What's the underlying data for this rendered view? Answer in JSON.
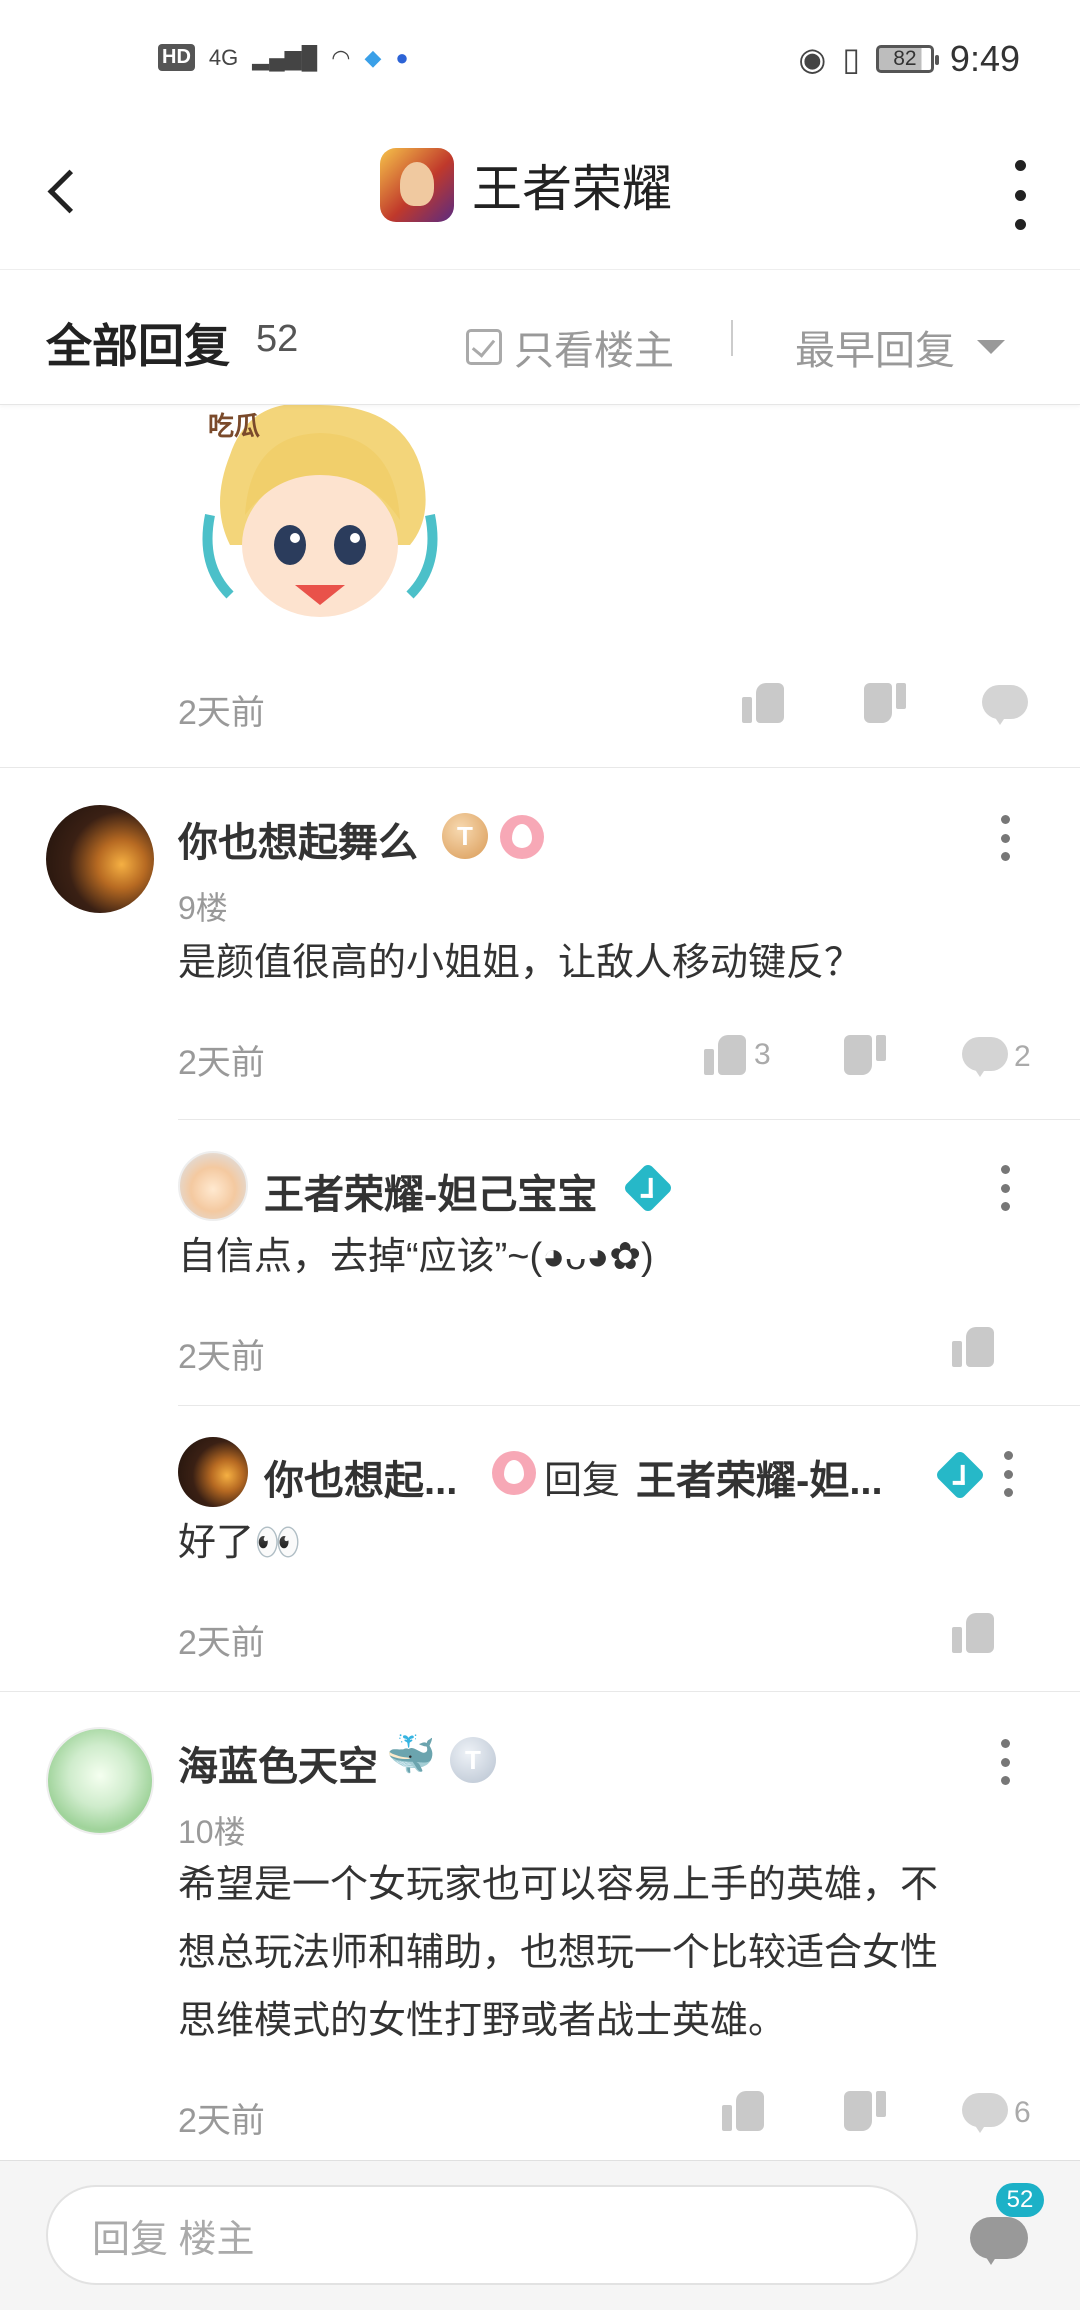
{
  "status_bar": {
    "left_icons": [
      "HD",
      "4G",
      "signal-icon",
      "wifi-icon",
      "app-icon",
      "baidu-icon"
    ],
    "hd": "HD",
    "network": "4G",
    "battery": "82",
    "time": "9:49"
  },
  "header": {
    "title": "王者荣耀",
    "back_icon": "chevron-left-icon",
    "more_icon": "more-vertical-icon"
  },
  "filter": {
    "title": "全部回复",
    "count": "52",
    "only_op": "只看楼主",
    "sort": "最早回复"
  },
  "top_post": {
    "time": "2天前"
  },
  "comments": [
    {
      "name": "你也想起舞么",
      "badge_t": "T",
      "floor": "9楼",
      "text": "是颜值很高的小姐姐，让敌人移动键反？",
      "time": "2天前",
      "likes": "3",
      "replies": "2",
      "sub_replies": [
        {
          "name": "王者荣耀-妲己宝宝",
          "text": "自信点，去掉“应该”~(◕ᴗ◕✿)",
          "time": "2天前"
        },
        {
          "name": "你也想起...",
          "reply_word": "回复",
          "reply_to": "王者荣耀-妲...",
          "text": "好了👀",
          "time": "2天前"
        }
      ]
    },
    {
      "name": "海蓝色天空",
      "emoji": "🐳",
      "badge_t": "T",
      "floor": "10楼",
      "text_lines": [
        "希望是一个女玩家也可以容易上手的英雄，不",
        "想总玩法师和辅助，也想玩一个比较适合女性",
        "思维模式的女性打野或者战士英雄。"
      ],
      "time": "2天前",
      "replies": "6"
    }
  ],
  "bottom": {
    "placeholder": "回复  楼主",
    "badge": "52"
  },
  "colors": {
    "accent": "#1cb1c7",
    "muted": "#999999",
    "text": "#333333"
  }
}
